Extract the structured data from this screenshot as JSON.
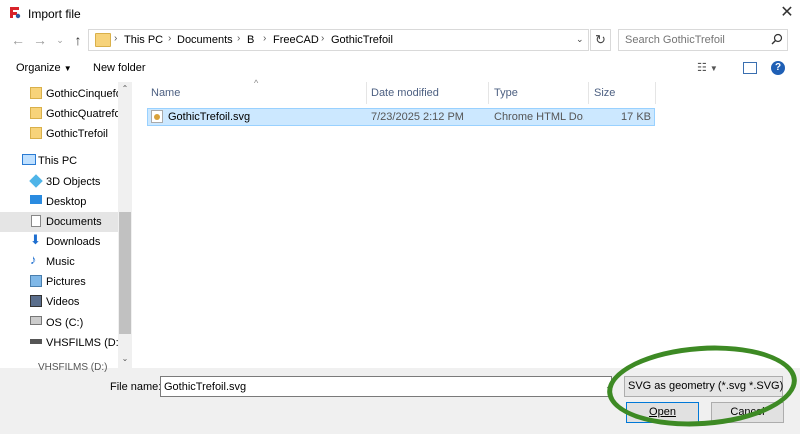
{
  "window": {
    "title": "Import file",
    "close_icon": "close-icon"
  },
  "address": {
    "crumbs": [
      "This PC",
      "Documents",
      "B",
      "FreeCAD",
      "GothicTrefoil"
    ]
  },
  "search": {
    "placeholder": "Search GothicTrefoil"
  },
  "toolbar": {
    "organize": "Organize",
    "new_folder": "New folder"
  },
  "nav": {
    "items": [
      {
        "label": "GothicCinquefoil",
        "icon": "folder-icon"
      },
      {
        "label": "GothicQuatrefoil",
        "icon": "folder-icon"
      },
      {
        "label": "GothicTrefoil",
        "icon": "folder-icon"
      },
      {
        "label": "This PC",
        "icon": "computer-icon"
      },
      {
        "label": "3D Objects",
        "icon": "cube-icon"
      },
      {
        "label": "Desktop",
        "icon": "desktop-icon"
      },
      {
        "label": "Documents",
        "icon": "document-icon"
      },
      {
        "label": "Downloads",
        "icon": "download-icon"
      },
      {
        "label": "Music",
        "icon": "music-icon"
      },
      {
        "label": "Pictures",
        "icon": "picture-icon"
      },
      {
        "label": "Videos",
        "icon": "video-icon"
      },
      {
        "label": "OS (C:)",
        "icon": "drive-icon"
      },
      {
        "label": "VHSFILMS (D:)",
        "icon": "drive-icon"
      }
    ],
    "cut_item": "VHSFILMS (D:)"
  },
  "columns": {
    "name": "Name",
    "date": "Date modified",
    "type": "Type",
    "size": "Size"
  },
  "files": [
    {
      "name": "GothicTrefoil.svg",
      "date": "7/23/2025 2:12 PM",
      "type": "Chrome HTML Do...",
      "size": "17 KB"
    }
  ],
  "footer": {
    "file_name_label": "File name:",
    "file_name_value": "GothicTrefoil.svg",
    "filter": "SVG as geometry (*.svg *.SVG)",
    "open": "Open",
    "cancel": "Cancel"
  },
  "colors": {
    "selection": "#cce8ff",
    "accent": "#0078d7",
    "annotation": "#3d8a24"
  }
}
